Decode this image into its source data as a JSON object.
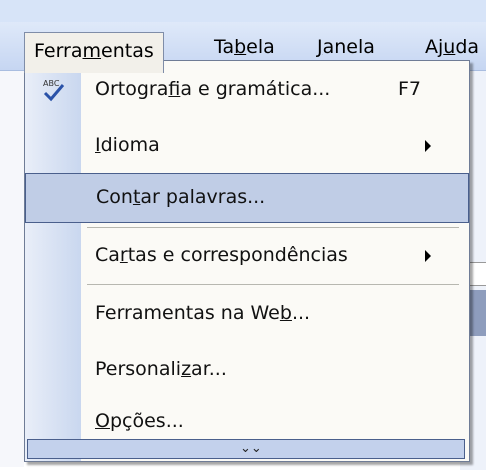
{
  "menubar": {
    "items": [
      {
        "label_pre": "Ferra",
        "label_u": "m",
        "label_post": "entas"
      },
      {
        "label_pre": "Ta",
        "label_u": "b",
        "label_post": "ela"
      },
      {
        "label_pre": "",
        "label_u": "J",
        "label_post": "anela"
      },
      {
        "label_pre": "Aj",
        "label_u": "u",
        "label_post": "da"
      }
    ]
  },
  "menu": {
    "items": [
      {
        "pre": "Ortogra",
        "u": "f",
        "post": "ia e gramática...",
        "shortcut": "F7"
      },
      {
        "pre": "",
        "u": "I",
        "post": "dioma"
      },
      {
        "pre": "Con",
        "u": "t",
        "post": "ar palavras..."
      },
      {
        "pre": "Ca",
        "u": "r",
        "post": "tas e correspondências"
      },
      {
        "pre": "Ferramentas na We",
        "u": "b",
        "post": "..."
      },
      {
        "pre": "Personali",
        "u": "z",
        "post": "ar..."
      },
      {
        "pre": "",
        "u": "O",
        "post": "pções..."
      }
    ],
    "expander_glyph": "⌄⌄"
  },
  "colors": {
    "highlight": "#c0cde6",
    "gutter": "#c9d7ef",
    "menubar": "#d7e4f8"
  }
}
